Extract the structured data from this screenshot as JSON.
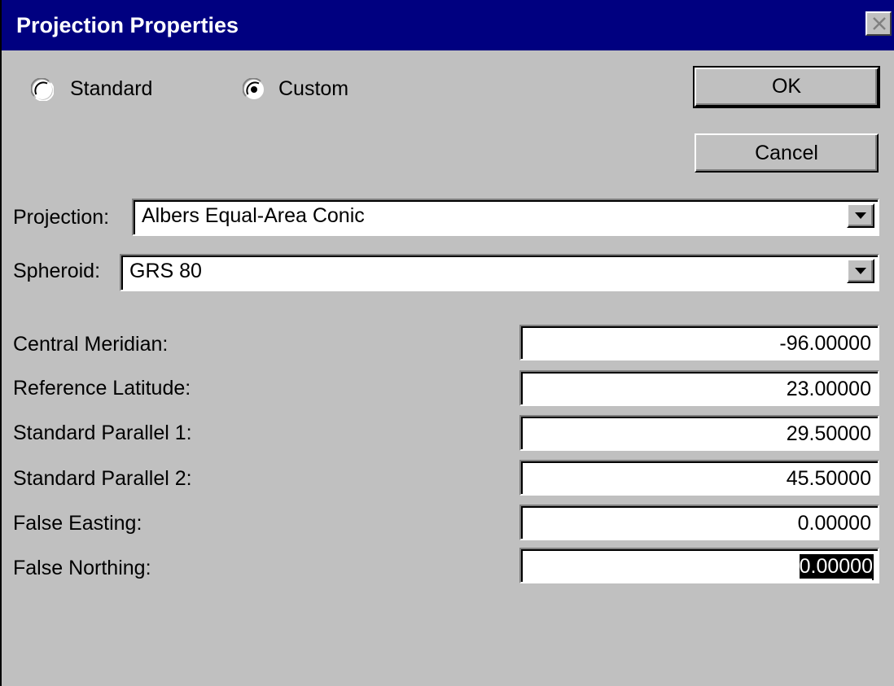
{
  "window": {
    "title": "Projection Properties"
  },
  "mode": {
    "standard_label": "Standard",
    "custom_label": "Custom",
    "selected": "Custom"
  },
  "buttons": {
    "ok_label": "OK",
    "cancel_label": "Cancel"
  },
  "projection": {
    "label": "Projection:",
    "value": "Albers Equal-Area Conic"
  },
  "spheroid": {
    "label": "Spheroid:",
    "value": "GRS 80"
  },
  "parameters": [
    {
      "label": "Central Meridian:",
      "value": "-96.00000"
    },
    {
      "label": "Reference Latitude:",
      "value": "23.00000"
    },
    {
      "label": "Standard Parallel 1:",
      "value": "29.50000"
    },
    {
      "label": "Standard Parallel 2:",
      "value": "45.50000"
    },
    {
      "label": "False Easting:",
      "value": "0.00000"
    },
    {
      "label": "False Northing:",
      "value": "0.00000"
    }
  ],
  "icons": {
    "close": "close-icon",
    "dropdown": "chevron-down-icon"
  },
  "colors": {
    "titlebar": "#000080",
    "dialog_bg": "#c0c0c0",
    "selection_bg": "#000000"
  }
}
